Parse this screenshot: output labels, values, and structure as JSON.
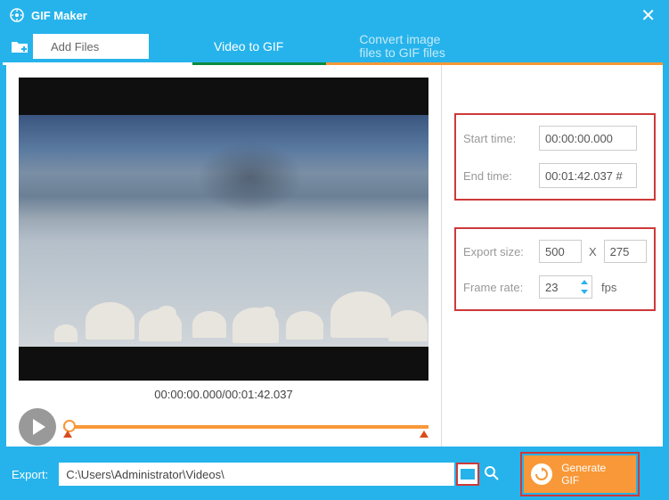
{
  "titlebar": {
    "title": "GIF Maker"
  },
  "tabs": {
    "add_files": "Add Files",
    "video_to_gif": "Video to GIF",
    "convert_image": "Convert image\nfiles to GIF files"
  },
  "player": {
    "timestamp": "00:00:00.000/00:01:42.037"
  },
  "settings": {
    "start_time_label": "Start time:",
    "start_time_value": "00:00:00.000",
    "end_time_label": "End time:",
    "end_time_value": "00:01:42.037 #",
    "export_size_label": "Export size:",
    "width": "500",
    "x_separator": "X",
    "height": "275",
    "frame_rate_label": "Frame rate:",
    "frame_rate_value": "23",
    "fps_unit": "fps"
  },
  "footer": {
    "export_label": "Export:",
    "export_path": "C:\\Users\\Administrator\\Videos\\",
    "generate_btn": "Generate\nGIF"
  }
}
